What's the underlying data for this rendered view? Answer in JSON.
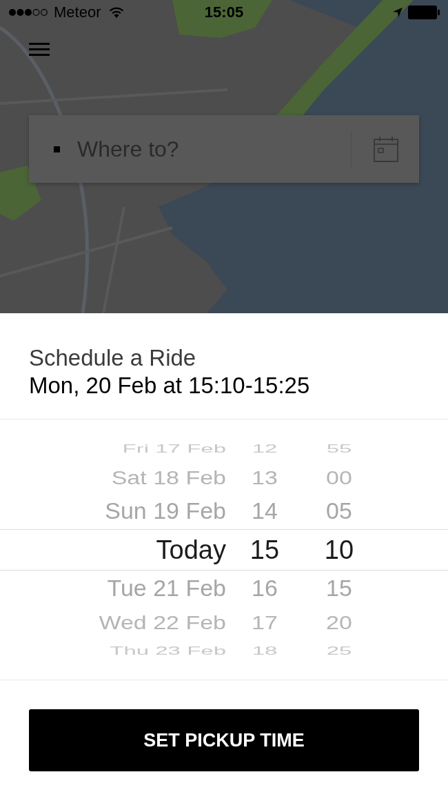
{
  "status_bar": {
    "carrier": "Meteor",
    "time": "15:05"
  },
  "search": {
    "placeholder": "Where to?"
  },
  "schedule": {
    "title": "Schedule a Ride",
    "summary": "Mon, 20 Feb at 15:10-15:25"
  },
  "picker": {
    "rows": [
      {
        "day": "Fri 17 Feb",
        "hour": "12",
        "minute": "55",
        "selected": false
      },
      {
        "day": "Sat 18 Feb",
        "hour": "13",
        "minute": "00",
        "selected": false
      },
      {
        "day": "Sun 19 Feb",
        "hour": "14",
        "minute": "05",
        "selected": false
      },
      {
        "day": "Today",
        "hour": "15",
        "minute": "10",
        "selected": true
      },
      {
        "day": "Tue 21 Feb",
        "hour": "16",
        "minute": "15",
        "selected": false
      },
      {
        "day": "Wed 22 Feb",
        "hour": "17",
        "minute": "20",
        "selected": false
      },
      {
        "day": "Thu 23 Feb",
        "hour": "18",
        "minute": "25",
        "selected": false
      }
    ]
  },
  "button": {
    "label": "SET PICKUP TIME"
  }
}
